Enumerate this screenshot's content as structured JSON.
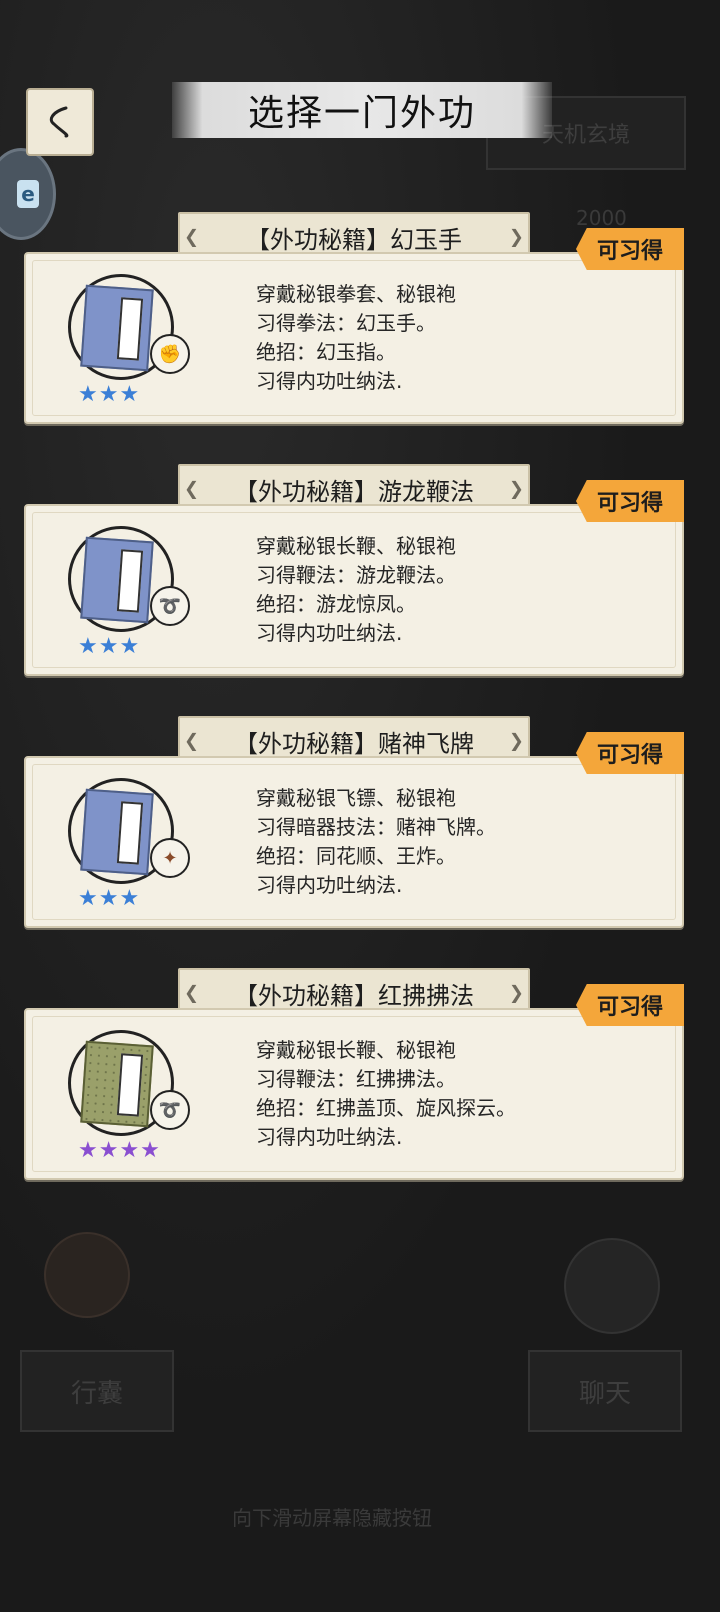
{
  "header": {
    "title": "选择一门外功",
    "right_button": "天机玄境",
    "currency": "2000"
  },
  "colors": {
    "badge": "#f4a63a",
    "star_blue": "#3b7fd6",
    "star_purple": "#8a4fd0"
  },
  "cards": [
    {
      "title": "【外功秘籍】幻玉手",
      "badge": "可习得",
      "book_style": "blue",
      "weapon_icon": "fist-icon",
      "stars": "★★★",
      "star_count": 3,
      "star_color": "blue",
      "lines": [
        "穿戴秘银拳套、秘银袍",
        "习得拳法：幻玉手。",
        "绝招：幻玉指。",
        "习得内功吐纳法."
      ]
    },
    {
      "title": "【外功秘籍】游龙鞭法",
      "badge": "可习得",
      "book_style": "blue",
      "weapon_icon": "whip-icon",
      "stars": "★★★",
      "star_count": 3,
      "star_color": "blue",
      "lines": [
        "穿戴秘银长鞭、秘银袍",
        "习得鞭法：游龙鞭法。",
        "绝招：游龙惊凤。",
        "习得内功吐纳法."
      ]
    },
    {
      "title": "【外功秘籍】赌神飞牌",
      "badge": "可习得",
      "book_style": "blue",
      "weapon_icon": "dart-icon",
      "stars": "★★★",
      "star_count": 3,
      "star_color": "blue",
      "lines": [
        "穿戴秘银飞镖、秘银袍",
        "习得暗器技法：赌神飞牌。",
        "绝招：同花顺、王炸。",
        "习得内功吐纳法."
      ]
    },
    {
      "title": "【外功秘籍】红拂拂法",
      "badge": "可习得",
      "book_style": "green",
      "weapon_icon": "whip-icon",
      "stars": "★★★★",
      "star_count": 4,
      "star_color": "purple",
      "lines": [
        "穿戴秘银长鞭、秘银袍",
        "习得鞭法：红拂拂法。",
        "绝招：红拂盖顶、旋风探云。",
        "习得内功吐纳法."
      ]
    }
  ],
  "footer": {
    "bag_label": "行囊",
    "chat_label": "聊天",
    "hint": "向下滑动屏幕隐藏按钮"
  }
}
